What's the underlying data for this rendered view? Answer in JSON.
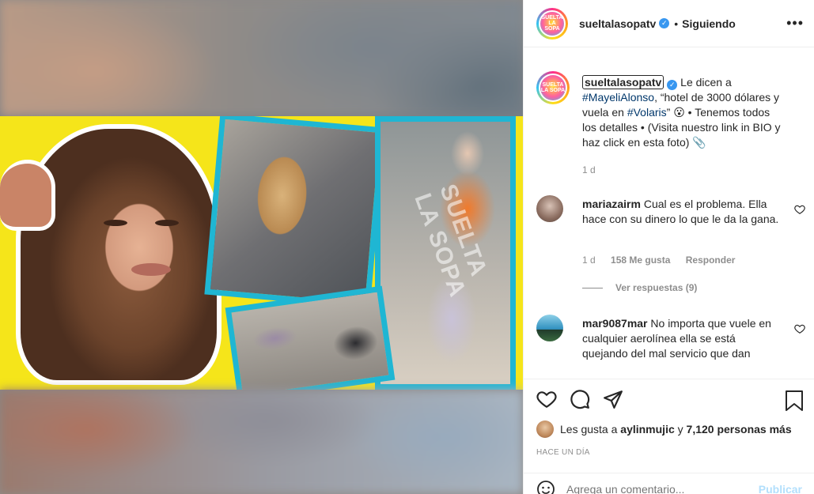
{
  "post": {
    "username": "sueltalasopatv",
    "follow_status": "Siguiendo",
    "dot": "•",
    "more": "•••",
    "avatar_text": "SUELTA LA SOPA"
  },
  "caption": {
    "username": "sueltalasopatv",
    "text_before": "Le dicen a",
    "tag1": "#MayeliAlonso",
    "text_mid": ", “hotel de 3000 dólares y vuela en",
    "tag2": "#Volaris",
    "text_after": "” 😮 • Tenemos todos los detalles • (Visita nuestro link in BIO y haz click en esta foto) 📎",
    "time": "1 d"
  },
  "comments": [
    {
      "username": "mariazairm",
      "text": "Cual es el problema. Ella hace con su dinero lo que le da la gana.",
      "time": "1 d",
      "likes": "158 Me gusta",
      "reply": "Responder",
      "view_replies": "Ver respuestas (9)"
    },
    {
      "username": "mar9087mar",
      "text": "No importa que vuele en cualquier aerolínea ella se está quejando del mal servicio que dan"
    }
  ],
  "likes": {
    "prefix": "Les gusta a",
    "user": "aylinmujic",
    "conj": "y",
    "count": "7,120 personas más"
  },
  "timestamp": "Hace un día",
  "comment_box": {
    "placeholder": "Agrega un comentario...",
    "publish": "Publicar"
  },
  "watermark": "SUELTA LA SOPA",
  "colors": {
    "accent_blue": "#3897f0",
    "collage_yellow": "#f5e51a",
    "frame_cyan": "#1fb6d3"
  }
}
